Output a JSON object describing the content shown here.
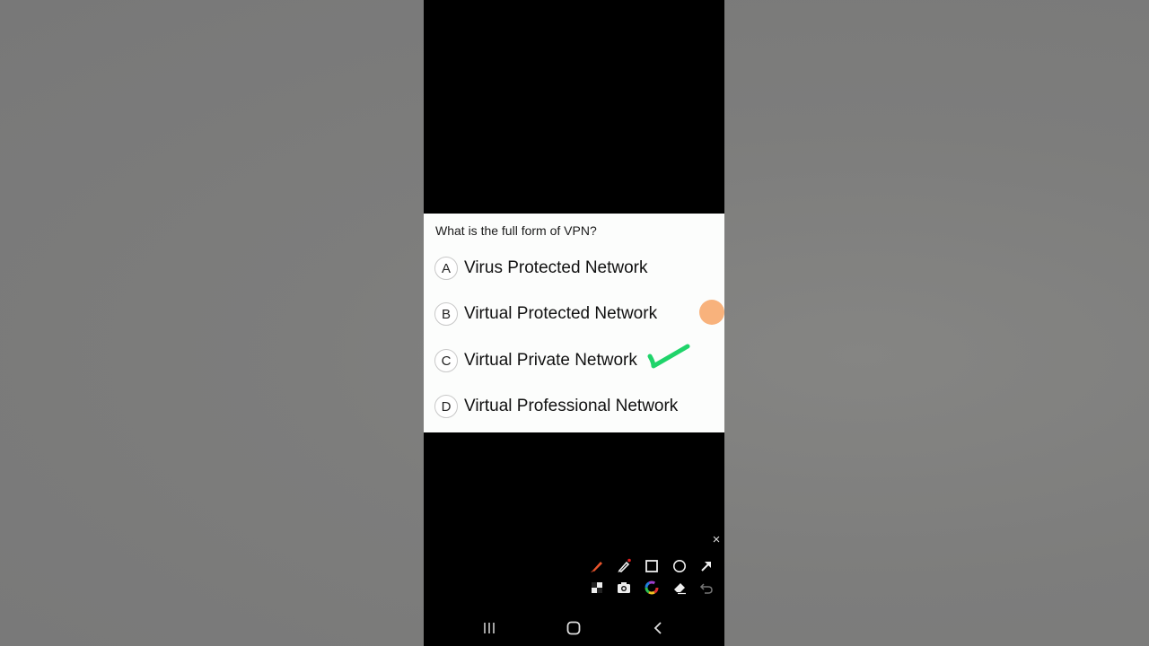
{
  "quiz": {
    "question": "What is the full form of VPN?",
    "options": [
      {
        "letter": "A",
        "text": "Virus Protected Network"
      },
      {
        "letter": "B",
        "text": "Virtual Protected Network"
      },
      {
        "letter": "C",
        "text": "Virtual Private Network"
      },
      {
        "letter": "D",
        "text": "Virtual Professional Network"
      }
    ],
    "marked_correct": "C"
  },
  "annotation_toolbar": {
    "close_label": "×",
    "tools": [
      "pen-icon",
      "highlighter-icon",
      "rectangle-icon",
      "circle-icon",
      "arrow-icon",
      "mosaic-icon",
      "camera-icon",
      "color-wheel-icon",
      "eraser-icon",
      "undo-icon"
    ]
  },
  "nav_bar": {
    "buttons": [
      "recents-icon",
      "home-icon",
      "back-icon"
    ]
  },
  "colors": {
    "checkmark": "#1fd46a",
    "touch_indicator": "#f7aa6e",
    "pen": "#e8542c",
    "highlighter_dot": "#e02020"
  }
}
